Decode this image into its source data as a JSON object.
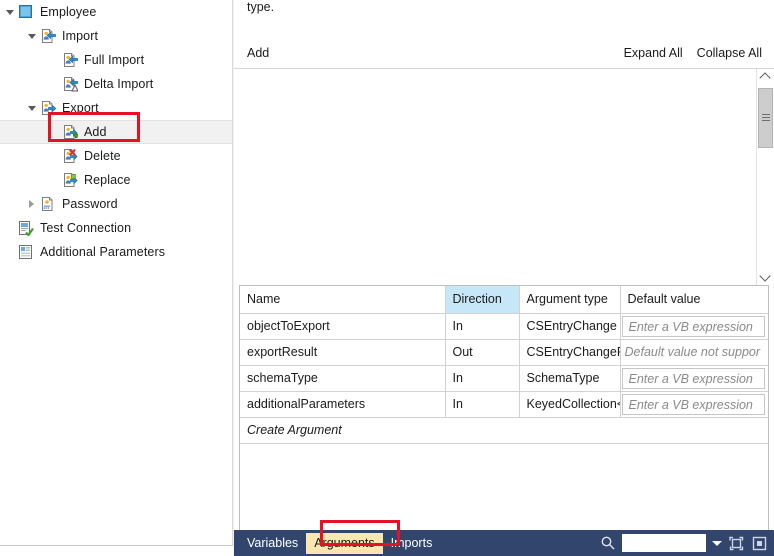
{
  "tree": {
    "items": [
      {
        "label": "Employee",
        "depth": 0,
        "expander": "down",
        "icon": "square-blue-icon",
        "selected": false
      },
      {
        "label": "Import",
        "depth": 1,
        "expander": "down",
        "icon": "import-page-icon",
        "selected": false
      },
      {
        "label": "Full Import",
        "depth": 2,
        "expander": "none",
        "icon": "full-import-page-icon",
        "selected": false
      },
      {
        "label": "Delta Import",
        "depth": 2,
        "expander": "none",
        "icon": "delta-import-page-icon",
        "selected": false
      },
      {
        "label": "Export",
        "depth": 1,
        "expander": "down",
        "icon": "export-page-icon",
        "selected": false
      },
      {
        "label": "Add",
        "depth": 2,
        "expander": "none",
        "icon": "export-add-page-icon",
        "selected": true
      },
      {
        "label": "Delete",
        "depth": 2,
        "expander": "none",
        "icon": "export-delete-page-icon",
        "selected": false
      },
      {
        "label": "Replace",
        "depth": 2,
        "expander": "none",
        "icon": "export-replace-page-icon",
        "selected": false
      },
      {
        "label": "Password",
        "depth": 1,
        "expander": "right",
        "icon": "password-page-icon",
        "selected": false
      },
      {
        "label": "Test Connection",
        "depth": 0,
        "expander": "none",
        "icon": "test-connection-icon",
        "selected": false
      },
      {
        "label": "Additional Parameters",
        "depth": 0,
        "expander": "none",
        "icon": "additional-parameters-icon",
        "selected": false
      }
    ]
  },
  "designer": {
    "hint_text": "type.",
    "add_link": "Add",
    "expand_all": "Expand All",
    "collapse_all": "Collapse All"
  },
  "arguments_grid": {
    "columns": [
      "Name",
      "Direction",
      "Argument type",
      "Default value"
    ],
    "highlighted_column": "Direction",
    "rows": [
      {
        "name": "objectToExport",
        "direction": "In",
        "type": "CSEntryChange",
        "default": "Enter a VB expression",
        "default_boxed": true
      },
      {
        "name": "exportResult",
        "direction": "Out",
        "type": "CSEntryChangeRes",
        "default": "Default value not suppor",
        "default_boxed": false
      },
      {
        "name": "schemaType",
        "direction": "In",
        "type": "SchemaType",
        "default": "Enter a VB expression",
        "default_boxed": true
      },
      {
        "name": "additionalParameters",
        "direction": "In",
        "type": "KeyedCollection<S",
        "default": "Enter a VB expression",
        "default_boxed": true
      }
    ],
    "create_row_label": "Create Argument"
  },
  "bottom_bar": {
    "tabs": [
      {
        "label": "Variables",
        "active": false
      },
      {
        "label": "Arguments",
        "active": true
      },
      {
        "label": "Imports",
        "active": false
      }
    ],
    "search_value": "",
    "icons": [
      "search-icon",
      "chevron-down-icon",
      "fit-to-screen-icon",
      "minimap-icon"
    ]
  },
  "annotations": {
    "accent_red": "#e81123",
    "tab_active_bg": "#fae6b0",
    "header_highlight_bg": "#c6e7f7",
    "bottom_bar_bg": "#31456d"
  }
}
